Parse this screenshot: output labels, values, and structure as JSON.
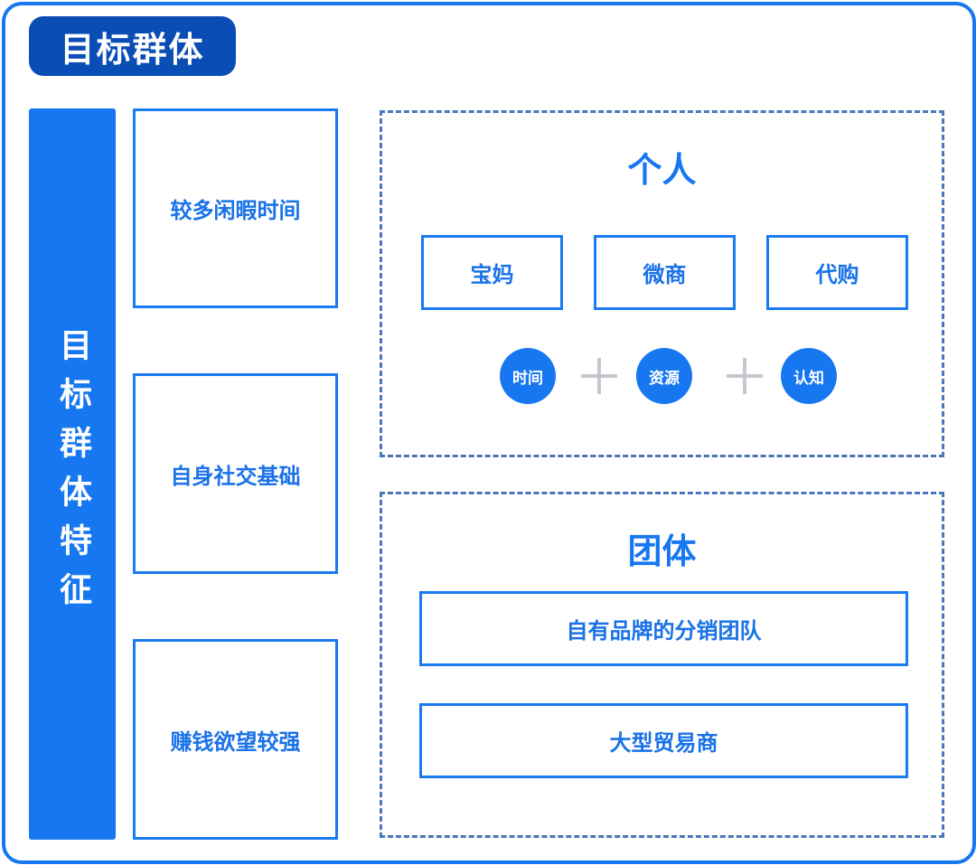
{
  "title": "目标群体",
  "side_label": "目标群体特征",
  "traits": [
    {
      "label": "较多闲暇时间"
    },
    {
      "label": "自身社交基础"
    },
    {
      "label": "赚钱欲望较强"
    }
  ],
  "individual": {
    "title": "个人",
    "types": [
      {
        "label": "宝妈"
      },
      {
        "label": "微商"
      },
      {
        "label": "代购"
      }
    ],
    "factors": [
      {
        "label": "时间"
      },
      {
        "label": "资源"
      },
      {
        "label": "认知"
      }
    ],
    "operator": "plus-icon"
  },
  "group": {
    "title": "团体",
    "types": [
      {
        "label": "自有品牌的分销团队"
      },
      {
        "label": "大型贸易商"
      }
    ]
  },
  "colors": {
    "primary": "#1677f0",
    "dark_badge": "#0a4db5",
    "dashed_border": "#4a78b8",
    "plus": "#c4c8ce"
  }
}
